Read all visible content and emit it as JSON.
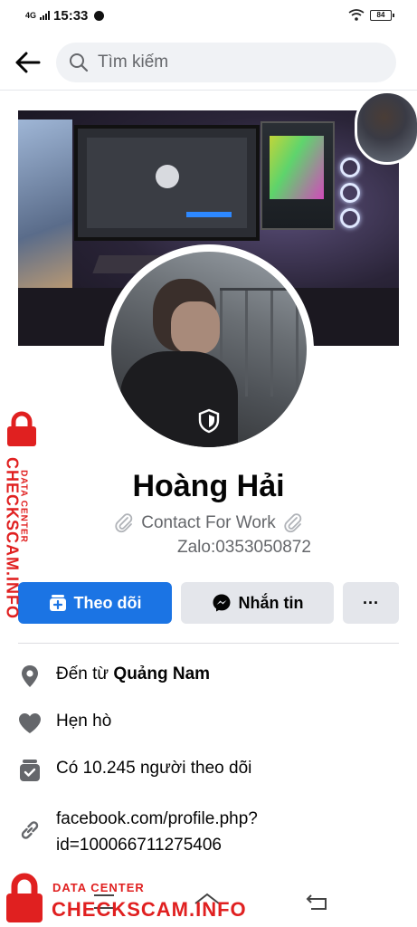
{
  "status_bar": {
    "network": "4G",
    "time": "15:33",
    "battery": "84"
  },
  "search": {
    "placeholder": "Tìm kiếm"
  },
  "profile": {
    "name": "Hoàng Hải",
    "bio_line1": "Contact For Work",
    "bio_line2": "Zalo:0353050872"
  },
  "buttons": {
    "follow": "Theo dõi",
    "message": "Nhắn tin",
    "more": "···"
  },
  "info": {
    "from_prefix": "Đến từ ",
    "from_place": "Quảng Nam",
    "dating": "Hẹn hò",
    "followers": "Có 10.245 người theo dõi",
    "link_line1": "facebook.com/profile.php?",
    "link_line2": "id=100066711275406"
  },
  "watermark": {
    "small": "DATA CENTER",
    "large": "CHECKSCAM.INFO"
  },
  "colors": {
    "accent": "#1b74e4",
    "watermark": "#e02020",
    "icon_gray": "#65676b"
  },
  "icons": [
    "back-arrow-icon",
    "search-icon",
    "shield-icon",
    "follow-plus-icon",
    "messenger-icon",
    "location-pin-icon",
    "heart-icon",
    "followers-icon",
    "link-icon",
    "lock-icon"
  ]
}
